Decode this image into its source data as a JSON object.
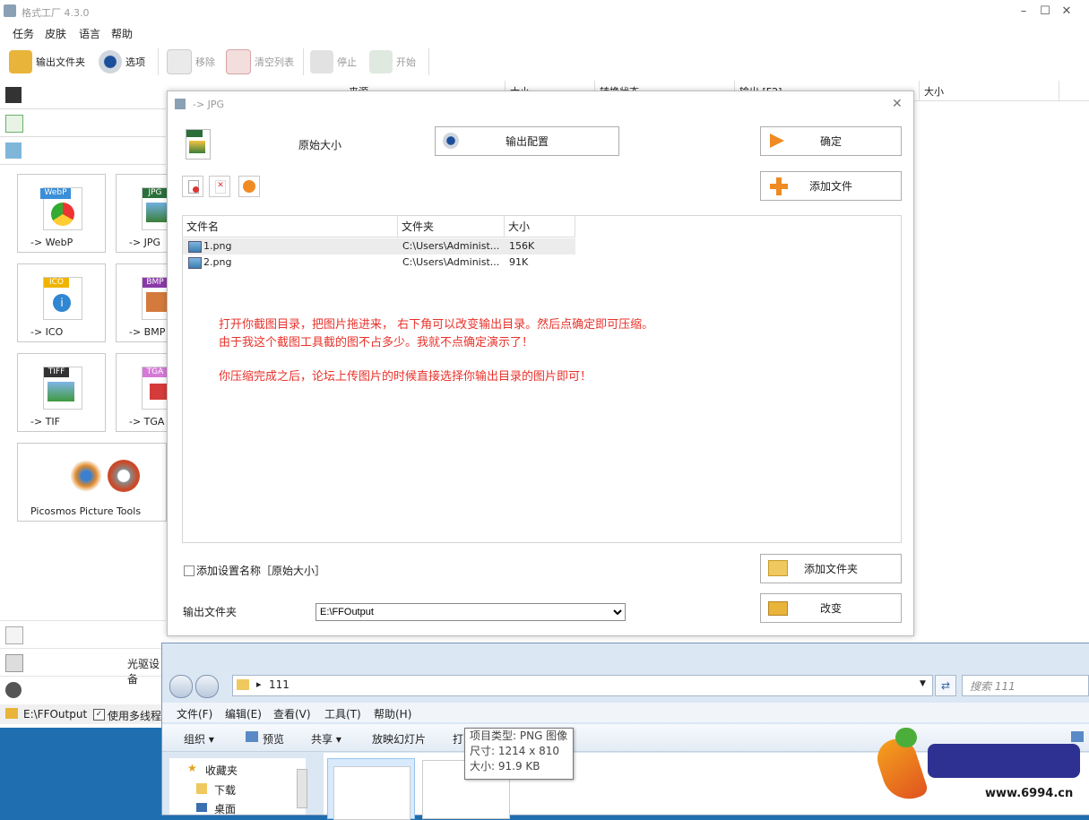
{
  "app": {
    "title": "格式工厂 4.3.0",
    "menu": [
      "任务",
      "皮肤",
      "语言",
      "帮助"
    ],
    "toolbar": {
      "output_folder": "输出文件夹",
      "options": "选项",
      "remove": "移除",
      "clear_list": "清空列表",
      "stop": "停止",
      "start": "开始"
    },
    "list_headers": [
      "来源",
      "大小",
      "转换状态",
      "输出 [F2]",
      "大小"
    ],
    "tiles": [
      {
        "label": "-> WebP",
        "badge": "WebP",
        "color": "#3a8fd8"
      },
      {
        "label": "-> JPG",
        "badge": "JPG",
        "color": "#2b6f3a"
      },
      {
        "label": "-> ICO",
        "badge": "ICO",
        "color": "#f0b400"
      },
      {
        "label": "-> BMP",
        "badge": "BMP",
        "color": "#8a3aa8"
      },
      {
        "label": "-> TIF",
        "badge": "TIFF",
        "color": "#333333"
      },
      {
        "label": "-> TGA",
        "badge": "TGA",
        "color": "#d57ad6"
      }
    ],
    "picosmos": "Picosmos Picture Tools",
    "bottom_labels": {
      "cd": "光驱设备"
    },
    "status": {
      "path": "E:\\FFOutput",
      "multithread": "使用多线程"
    }
  },
  "dialog": {
    "title": "-> JPG",
    "preset": "原始大小",
    "output_config": "输出配置",
    "ok": "确定",
    "add_file": "添加文件",
    "columns": [
      "文件名",
      "文件夹",
      "大小"
    ],
    "files": [
      {
        "name": "1.png",
        "folder": "C:\\Users\\Administ...",
        "size": "156K"
      },
      {
        "name": "2.png",
        "folder": "C:\\Users\\Administ...",
        "size": "91K"
      }
    ],
    "note_line1": "打开你截图目录，把图片拖进来， 右下角可以改变输出目录。然后点确定即可压缩。",
    "note_line2": "由于我这个截图工具截的图不占多少。我就不点确定演示了！",
    "note_line3": "你压缩完成之后，论坛上传图片的时候直接选择你输出目录的图片即可！",
    "add_setting_name": "添加设置名称［原始大小］",
    "add_folder": "添加文件夹",
    "output_folder_label": "输出文件夹",
    "output_folder_value": "E:\\FFOutput",
    "change": "改变"
  },
  "explorer": {
    "address": "111",
    "search_placeholder": "搜索 111",
    "menu": [
      "文件(F)",
      "编辑(E)",
      "查看(V)",
      "工具(T)",
      "帮助(H)"
    ],
    "commands": [
      "组织 ▾",
      "预览",
      "共享 ▾",
      "放映幻灯片",
      "打"
    ],
    "nav": [
      "收藏夹",
      "下载",
      "桌面"
    ],
    "tooltip": {
      "type": "项目类型: PNG 图像",
      "dims": "尺寸: 1214 x 810",
      "size": "大小: 91.9 KB"
    }
  },
  "watermark": {
    "site": "www.6994.cn"
  }
}
